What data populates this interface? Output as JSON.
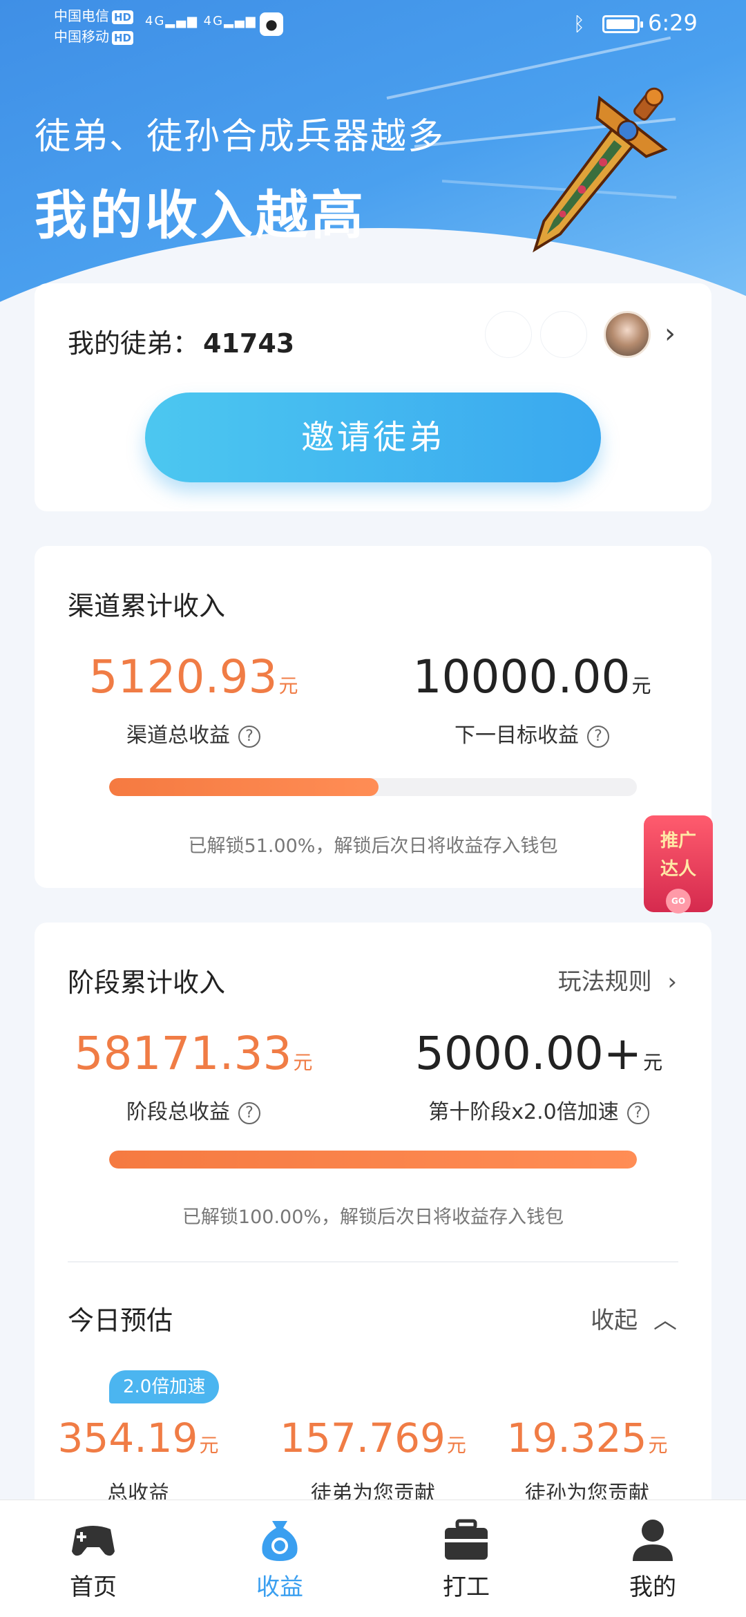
{
  "status_bar": {
    "carrier1": "中国电信",
    "carrier2": "中国移动",
    "hd": "HD",
    "network": "4G",
    "time": "6:29"
  },
  "hero": {
    "subtitle": "徒弟、徒孙合成兵器越多",
    "title": "我的收入越高"
  },
  "disciples": {
    "label": "我的徒弟：",
    "count": "41743",
    "invite_button": "邀请徒弟"
  },
  "channel": {
    "title": "渠道累计收入",
    "total_value": "5120.93",
    "total_unit": "元",
    "total_label": "渠道总收益",
    "target_value": "10000.00",
    "target_unit": "元",
    "target_label": "下一目标收益",
    "progress": 0.51,
    "note": "已解锁51.00%，解锁后次日将收益存入钱包"
  },
  "stage": {
    "title": "阶段累计收入",
    "rules_link": "玩法规则",
    "total_value": "58171.33",
    "total_unit": "元",
    "total_label": "阶段总收益",
    "target_value": "5000.00+",
    "target_unit": "元",
    "target_label": "第十阶段x2.0倍加速",
    "progress": 1.0,
    "note": "已解锁100.00%，解锁后次日将收益存入钱包"
  },
  "today": {
    "title": "今日预估",
    "collapse_label": "收起",
    "boost_badge": "2.0倍加速",
    "items": [
      {
        "value": "354.19",
        "unit": "元",
        "label": "总收益"
      },
      {
        "value": "157.769",
        "unit": "元",
        "label": "徒弟为您贡献"
      },
      {
        "value": "19.325",
        "unit": "元",
        "label": "徒孙为您贡献"
      }
    ]
  },
  "promo": {
    "line1": "推广",
    "line2": "达人",
    "go": "GO"
  },
  "tabs": [
    {
      "label": "首页",
      "icon": "gamepad-icon"
    },
    {
      "label": "收益",
      "icon": "money-bag-icon"
    },
    {
      "label": "打工",
      "icon": "toolbox-icon"
    },
    {
      "label": "我的",
      "icon": "person-icon"
    }
  ],
  "colors": {
    "accent": "#3a9ff0",
    "orange": "#f07c45"
  }
}
